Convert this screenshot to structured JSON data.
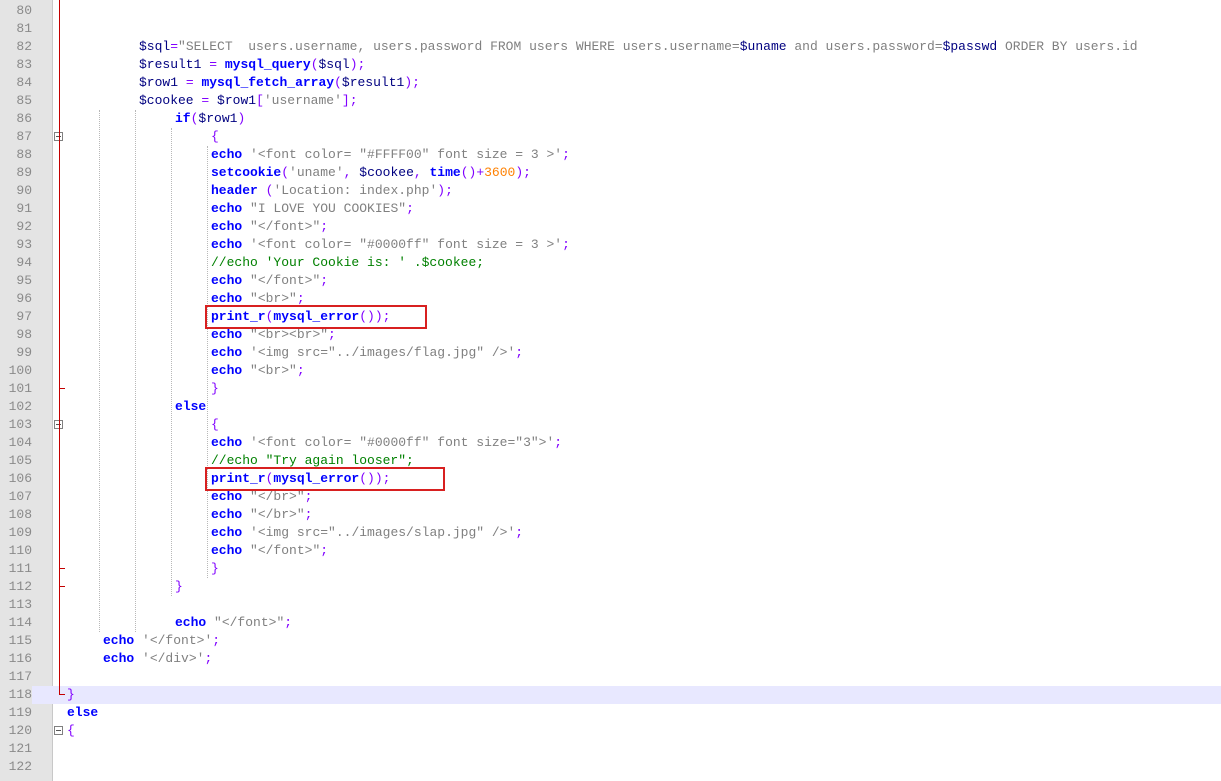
{
  "editor": {
    "lines": [
      {
        "n": "80",
        "i": 0,
        "t": []
      },
      {
        "n": "81",
        "i": 0,
        "t": []
      },
      {
        "n": "82",
        "i": 8,
        "t": [
          [
            "var",
            "$sql"
          ],
          [
            "op",
            "="
          ],
          [
            "str",
            "\"SELECT  users.username, users.password FROM users WHERE users.username="
          ],
          [
            "var",
            "$uname"
          ],
          [
            "str",
            " and users.password="
          ],
          [
            "var",
            "$passwd"
          ],
          [
            "str",
            " ORDER BY users.id"
          ]
        ]
      },
      {
        "n": "83",
        "i": 8,
        "t": [
          [
            "var",
            "$result1"
          ],
          [
            "def",
            " "
          ],
          [
            "op",
            "="
          ],
          [
            "def",
            " "
          ],
          [
            "kw",
            "mysql_query"
          ],
          [
            "op",
            "("
          ],
          [
            "var",
            "$sql"
          ],
          [
            "op",
            ");"
          ]
        ]
      },
      {
        "n": "84",
        "i": 8,
        "t": [
          [
            "var",
            "$row1"
          ],
          [
            "def",
            " "
          ],
          [
            "op",
            "="
          ],
          [
            "def",
            " "
          ],
          [
            "kw",
            "mysql_fetch_array"
          ],
          [
            "op",
            "("
          ],
          [
            "var",
            "$result1"
          ],
          [
            "op",
            ");"
          ]
        ]
      },
      {
        "n": "85",
        "i": 8,
        "t": [
          [
            "var",
            "$cookee"
          ],
          [
            "def",
            " "
          ],
          [
            "op",
            "="
          ],
          [
            "def",
            " "
          ],
          [
            "var",
            "$row1"
          ],
          [
            "op",
            "["
          ],
          [
            "str",
            "'username'"
          ],
          [
            "op",
            "];"
          ]
        ]
      },
      {
        "n": "86",
        "i": 12,
        "t": [
          [
            "kw",
            "if"
          ],
          [
            "op",
            "("
          ],
          [
            "var",
            "$row1"
          ],
          [
            "op",
            ")"
          ]
        ]
      },
      {
        "n": "87",
        "i": 16,
        "t": [
          [
            "op",
            "{"
          ]
        ],
        "fold": "start"
      },
      {
        "n": "88",
        "i": 16,
        "t": [
          [
            "kw",
            "echo"
          ],
          [
            "def",
            " "
          ],
          [
            "str",
            "'<font color= \"#FFFF00\" font size = 3 >'"
          ],
          [
            "op",
            ";"
          ]
        ]
      },
      {
        "n": "89",
        "i": 16,
        "t": [
          [
            "kw",
            "setcookie"
          ],
          [
            "op",
            "("
          ],
          [
            "str",
            "'uname'"
          ],
          [
            "op",
            ","
          ],
          [
            "def",
            " "
          ],
          [
            "var",
            "$cookee"
          ],
          [
            "op",
            ","
          ],
          [
            "def",
            " "
          ],
          [
            "kw",
            "time"
          ],
          [
            "op",
            "()+"
          ],
          [
            "num",
            "3600"
          ],
          [
            "op",
            ");"
          ]
        ]
      },
      {
        "n": "90",
        "i": 16,
        "t": [
          [
            "kw",
            "header"
          ],
          [
            "def",
            " "
          ],
          [
            "op",
            "("
          ],
          [
            "str",
            "'Location: index.php'"
          ],
          [
            "op",
            ");"
          ]
        ]
      },
      {
        "n": "91",
        "i": 16,
        "t": [
          [
            "kw",
            "echo"
          ],
          [
            "def",
            " "
          ],
          [
            "str",
            "\"I LOVE YOU COOKIES\""
          ],
          [
            "op",
            ";"
          ]
        ]
      },
      {
        "n": "92",
        "i": 16,
        "t": [
          [
            "kw",
            "echo"
          ],
          [
            "def",
            " "
          ],
          [
            "str",
            "\"</font>\""
          ],
          [
            "op",
            ";"
          ]
        ]
      },
      {
        "n": "93",
        "i": 16,
        "t": [
          [
            "kw",
            "echo"
          ],
          [
            "def",
            " "
          ],
          [
            "str",
            "'<font color= \"#0000ff\" font size = 3 >'"
          ],
          [
            "op",
            ";"
          ]
        ]
      },
      {
        "n": "94",
        "i": 16,
        "t": [
          [
            "cmt",
            "//echo 'Your Cookie is: ' .$cookee;"
          ]
        ]
      },
      {
        "n": "95",
        "i": 16,
        "t": [
          [
            "kw",
            "echo"
          ],
          [
            "def",
            " "
          ],
          [
            "str",
            "\"</font>\""
          ],
          [
            "op",
            ";"
          ]
        ]
      },
      {
        "n": "96",
        "i": 16,
        "t": [
          [
            "kw",
            "echo"
          ],
          [
            "def",
            " "
          ],
          [
            "str",
            "\"<br>\""
          ],
          [
            "op",
            ";"
          ]
        ]
      },
      {
        "n": "97",
        "i": 16,
        "t": [
          [
            "kw",
            "print_r"
          ],
          [
            "op",
            "("
          ],
          [
            "kw",
            "mysql_error"
          ],
          [
            "op",
            "());"
          ]
        ]
      },
      {
        "n": "98",
        "i": 16,
        "t": [
          [
            "kw",
            "echo"
          ],
          [
            "def",
            " "
          ],
          [
            "str",
            "\"<br><br>\""
          ],
          [
            "op",
            ";"
          ]
        ]
      },
      {
        "n": "99",
        "i": 16,
        "t": [
          [
            "kw",
            "echo"
          ],
          [
            "def",
            " "
          ],
          [
            "str",
            "'<img src=\"../images/flag.jpg\" />'"
          ],
          [
            "op",
            ";"
          ]
        ]
      },
      {
        "n": "100",
        "i": 16,
        "t": [
          [
            "kw",
            "echo"
          ],
          [
            "def",
            " "
          ],
          [
            "str",
            "\"<br>\""
          ],
          [
            "op",
            ";"
          ]
        ]
      },
      {
        "n": "101",
        "i": 16,
        "t": [
          [
            "op",
            "}"
          ]
        ],
        "fold": "end"
      },
      {
        "n": "102",
        "i": 12,
        "t": [
          [
            "kw",
            "else"
          ]
        ]
      },
      {
        "n": "103",
        "i": 16,
        "t": [
          [
            "op",
            "{"
          ]
        ],
        "fold": "start"
      },
      {
        "n": "104",
        "i": 16,
        "t": [
          [
            "kw",
            "echo"
          ],
          [
            "def",
            " "
          ],
          [
            "str",
            "'<font color= \"#0000ff\" font size=\"3\">'"
          ],
          [
            "op",
            ";"
          ]
        ]
      },
      {
        "n": "105",
        "i": 16,
        "t": [
          [
            "cmt",
            "//echo \"Try again looser\";"
          ]
        ]
      },
      {
        "n": "106",
        "i": 16,
        "t": [
          [
            "kw",
            "print_r"
          ],
          [
            "op",
            "("
          ],
          [
            "kw",
            "mysql_error"
          ],
          [
            "op",
            "());"
          ]
        ]
      },
      {
        "n": "107",
        "i": 16,
        "t": [
          [
            "kw",
            "echo"
          ],
          [
            "def",
            " "
          ],
          [
            "str",
            "\"</br>\""
          ],
          [
            "op",
            ";"
          ]
        ]
      },
      {
        "n": "108",
        "i": 16,
        "t": [
          [
            "kw",
            "echo"
          ],
          [
            "def",
            " "
          ],
          [
            "str",
            "\"</br>\""
          ],
          [
            "op",
            ";"
          ]
        ]
      },
      {
        "n": "109",
        "i": 16,
        "t": [
          [
            "kw",
            "echo"
          ],
          [
            "def",
            " "
          ],
          [
            "str",
            "'<img src=\"../images/slap.jpg\" />'"
          ],
          [
            "op",
            ";"
          ]
        ]
      },
      {
        "n": "110",
        "i": 16,
        "t": [
          [
            "kw",
            "echo"
          ],
          [
            "def",
            " "
          ],
          [
            "str",
            "\"</font>\""
          ],
          [
            "op",
            ";"
          ]
        ]
      },
      {
        "n": "111",
        "i": 16,
        "t": [
          [
            "op",
            "}"
          ]
        ],
        "fold": "end"
      },
      {
        "n": "112",
        "i": 12,
        "t": [
          [
            "op",
            "}"
          ]
        ],
        "fold": "end"
      },
      {
        "n": "113",
        "i": 0,
        "t": []
      },
      {
        "n": "114",
        "i": 12,
        "t": [
          [
            "kw",
            "echo"
          ],
          [
            "def",
            " "
          ],
          [
            "str",
            "\"</font>\""
          ],
          [
            "op",
            ";"
          ]
        ]
      },
      {
        "n": "115",
        "i": 4,
        "t": [
          [
            "kw",
            "echo"
          ],
          [
            "def",
            " "
          ],
          [
            "str",
            "'</font>'"
          ],
          [
            "op",
            ";"
          ]
        ]
      },
      {
        "n": "116",
        "i": 4,
        "t": [
          [
            "kw",
            "echo"
          ],
          [
            "def",
            " "
          ],
          [
            "str",
            "'</div>'"
          ],
          [
            "op",
            ";"
          ]
        ]
      },
      {
        "n": "117",
        "i": 0,
        "t": []
      },
      {
        "n": "118",
        "i": 0,
        "t": [
          [
            "op",
            "}"
          ]
        ],
        "fold": "end",
        "current": true
      },
      {
        "n": "119",
        "i": 0,
        "t": [
          [
            "kw",
            "else"
          ]
        ]
      },
      {
        "n": "120",
        "i": 0,
        "t": [
          [
            "op",
            "{"
          ]
        ],
        "fold": "start"
      },
      {
        "n": "121",
        "i": 0,
        "t": []
      },
      {
        "n": "122",
        "i": 0,
        "t": []
      }
    ],
    "highlights": [
      {
        "line": "97"
      },
      {
        "line": "106"
      }
    ],
    "colors": {
      "keyword": "#0000ff",
      "variable": "#000080",
      "operator": "#8000ff",
      "string": "#808080",
      "number": "#ff8000",
      "comment": "#008000",
      "highlight_box": "#d82020",
      "fold_marker": "#c40000"
    }
  }
}
